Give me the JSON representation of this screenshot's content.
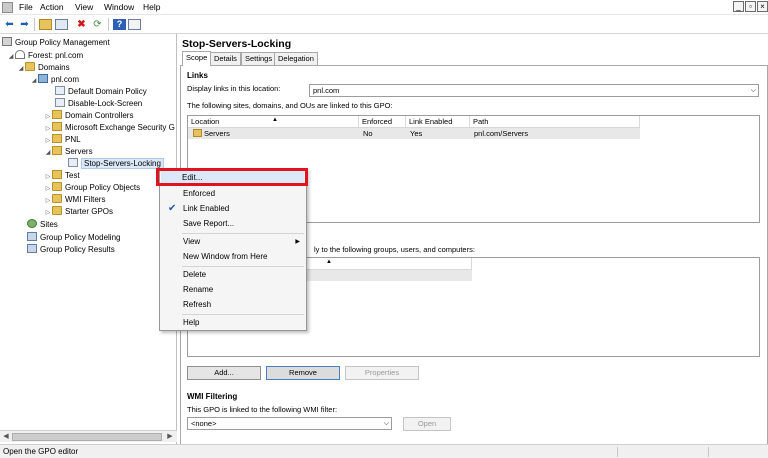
{
  "menubar": {
    "items": [
      "File",
      "Action",
      "View",
      "Window",
      "Help"
    ],
    "window_buttons": [
      "_",
      "▫",
      "×"
    ]
  },
  "toolbar": {
    "icons": [
      "back-arrow-icon",
      "forward-arrow-icon",
      "up-folder-icon",
      "show-hide-tree-icon",
      "delete-icon",
      "refresh-icon",
      "help-icon",
      "properties-icon"
    ]
  },
  "tree": {
    "items": [
      {
        "label": "Group Policy Management",
        "icon": "gpm-icon"
      },
      {
        "label": "Forest: pnl.com",
        "icon": "forest-icon"
      },
      {
        "label": "Domains",
        "icon": "folder-icon"
      },
      {
        "label": "pnl.com",
        "icon": "domain-icon"
      },
      {
        "label": "Default Domain Policy",
        "icon": "gpo-link-icon"
      },
      {
        "label": "Disable-Lock-Screen",
        "icon": "gpo-link-icon"
      },
      {
        "label": "Domain Controllers",
        "icon": "ou-icon"
      },
      {
        "label": "Microsoft Exchange Security G",
        "icon": "ou-icon"
      },
      {
        "label": "PNL",
        "icon": "ou-icon"
      },
      {
        "label": "Servers",
        "icon": "ou-icon"
      },
      {
        "label": "Stop-Servers-Locking",
        "icon": "gpo-link-icon"
      },
      {
        "label": "Test",
        "icon": "ou-icon"
      },
      {
        "label": "Group Policy Objects",
        "icon": "folder-icon"
      },
      {
        "label": "WMI Filters",
        "icon": "folder-icon"
      },
      {
        "label": "Starter GPOs",
        "icon": "folder-icon"
      },
      {
        "label": "Sites",
        "icon": "sites-icon"
      },
      {
        "label": "Group Policy Modeling",
        "icon": "modeling-icon"
      },
      {
        "label": "Group Policy Results",
        "icon": "results-icon"
      }
    ]
  },
  "gpo": {
    "title": "Stop-Servers-Locking",
    "tabs": [
      "Scope",
      "Details",
      "Settings",
      "Delegation"
    ],
    "links": {
      "title": "Links",
      "display_label": "Display links in this location:",
      "location_value": "pnl.com",
      "linked_text": "The following sites, domains, and OUs are linked to this GPO:",
      "columns": [
        "Location",
        "Enforced",
        "Link Enabled",
        "Path"
      ],
      "rows": [
        {
          "location": "Servers",
          "enforced": "No",
          "link_enabled": "Yes",
          "path": "pnl.com/Servers"
        }
      ]
    },
    "security": {
      "text_partial": "ly to the following groups, users, and computers:"
    },
    "buttons": {
      "add": "Add...",
      "remove": "Remove",
      "properties": "Properties"
    },
    "wmi": {
      "title": "WMI Filtering",
      "text": "This GPO is linked to the following WMI filter:",
      "value": "<none>",
      "open": "Open"
    }
  },
  "context_menu": {
    "edit": "Edit...",
    "enforced": "Enforced",
    "link_enabled": "Link Enabled",
    "link_enabled_checked": true,
    "save_report": "Save Report...",
    "view": "View",
    "new_window": "New Window from Here",
    "delete": "Delete",
    "rename": "Rename",
    "refresh": "Refresh",
    "help": "Help"
  },
  "status": {
    "text": "Open the GPO editor"
  },
  "colors": {
    "highlight_box": "#e0141e",
    "selection": "#d9e7f7"
  }
}
